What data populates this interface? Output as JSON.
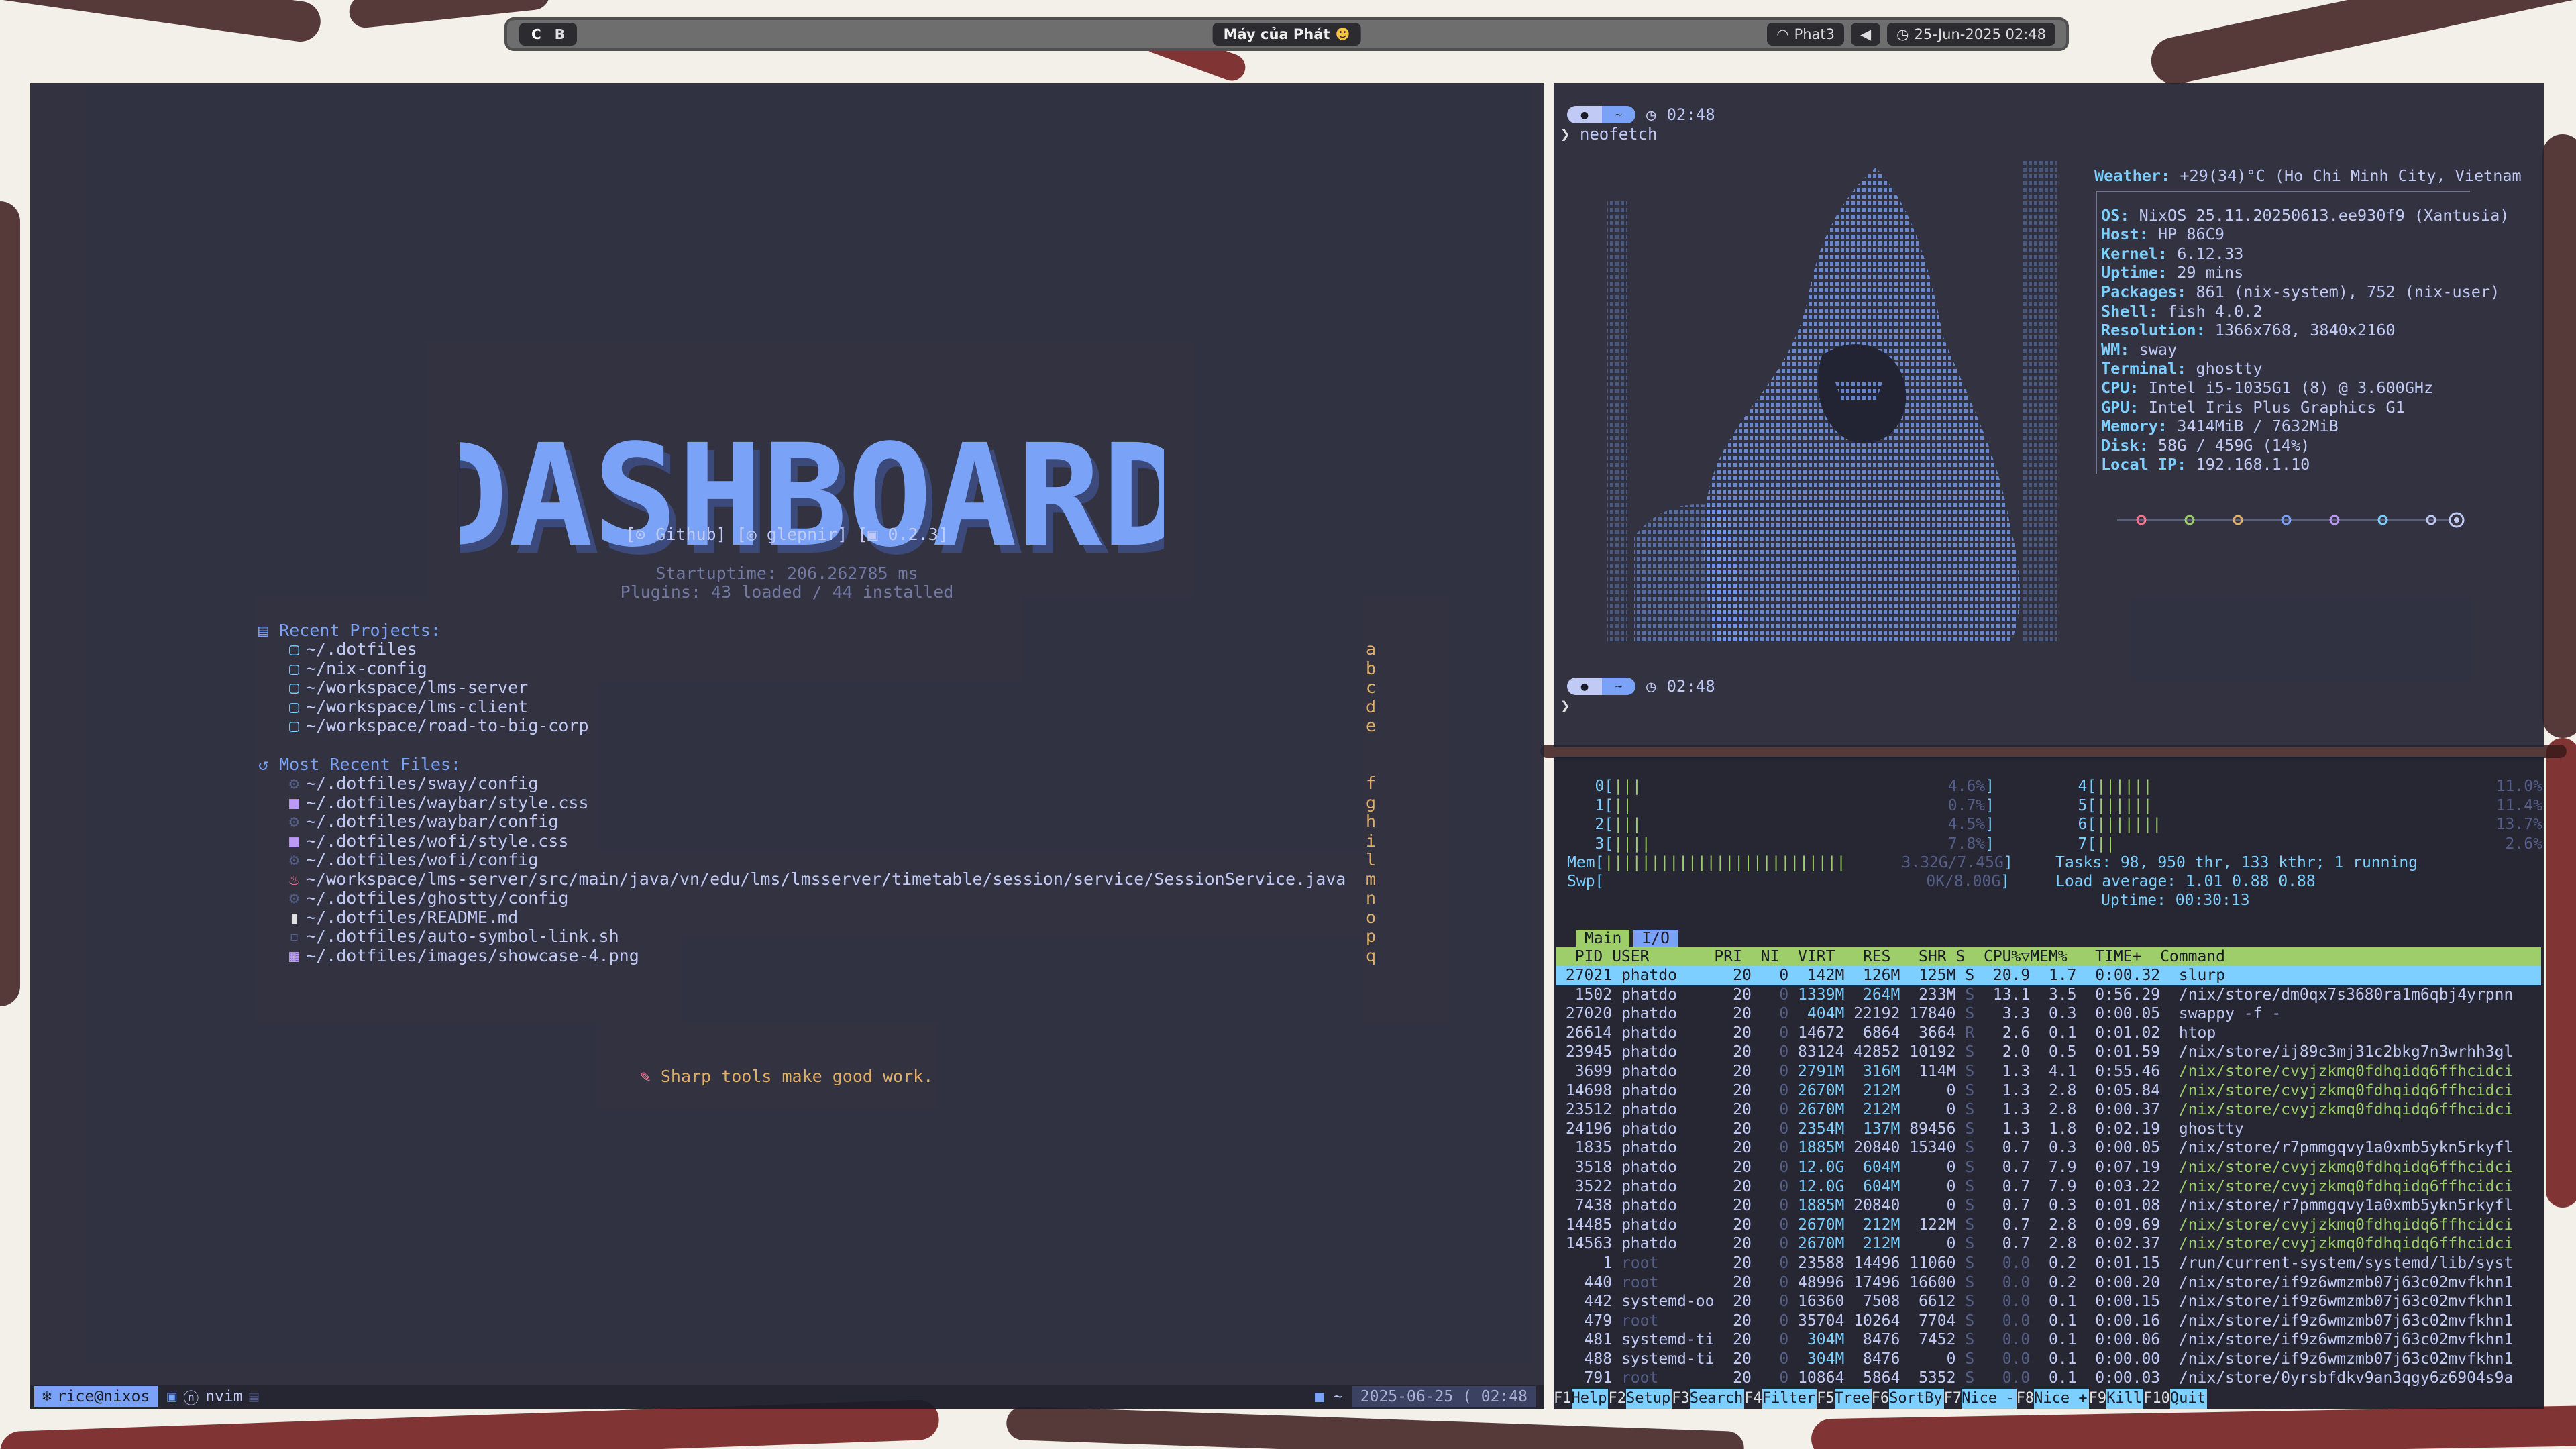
{
  "topbar": {
    "workspaces": [
      "C",
      "B"
    ],
    "title": "Máy của Phát",
    "wifi": "Phat3",
    "datetime": "25-Jun-2025 02:48"
  },
  "nvim": {
    "logo_text": "DASHBOARD",
    "links": {
      "github": "Github",
      "user": "glepnir",
      "version": "0.2.3"
    },
    "startuptime": "Startuptime: 206.262785 ms",
    "plugins": "Plugins: 43 loaded / 44 installed",
    "recent_projects": {
      "title": "Recent Projects:",
      "items": [
        {
          "path": "~/.dotfiles",
          "key": "a"
        },
        {
          "path": "~/nix-config",
          "key": "b"
        },
        {
          "path": "~/workspace/lms-server",
          "key": "c"
        },
        {
          "path": "~/workspace/lms-client",
          "key": "d"
        },
        {
          "path": "~/workspace/road-to-big-corp",
          "key": "e"
        }
      ]
    },
    "recent_files": {
      "title": "Most Recent Files:",
      "items": [
        {
          "path": "~/.dotfiles/sway/config",
          "key": "f",
          "icon": "gear-icon"
        },
        {
          "path": "~/.dotfiles/waybar/style.css",
          "key": "g",
          "icon": "css-icon"
        },
        {
          "path": "~/.dotfiles/waybar/config",
          "key": "h",
          "icon": "gear-icon"
        },
        {
          "path": "~/.dotfiles/wofi/style.css",
          "key": "i",
          "icon": "css-icon"
        },
        {
          "path": "~/.dotfiles/wofi/config",
          "key": "l",
          "icon": "gear-icon"
        },
        {
          "path": "~/workspace/lms-server/src/main/java/vn/edu/lms/lmsserver/timetable/session/service/SessionService.java",
          "key": "m",
          "icon": "java-icon"
        },
        {
          "path": "~/.dotfiles/ghostty/config",
          "key": "n",
          "icon": "gear-icon"
        },
        {
          "path": "~/.dotfiles/README.md",
          "key": "o",
          "icon": "markdown-icon"
        },
        {
          "path": "~/.dotfiles/auto-symbol-link.sh",
          "key": "p",
          "icon": "shell-icon"
        },
        {
          "path": "~/.dotfiles/images/showcase-4.png",
          "key": "q",
          "icon": "image-icon"
        }
      ]
    },
    "quote": "Sharp tools make good work.",
    "statusline": {
      "user": "rice@nixos",
      "mode": "nvim",
      "cwd": "~",
      "datetime": "2025-06-25 ( 02:48"
    }
  },
  "neofetch": {
    "time": "02:48",
    "command": "neofetch",
    "weather_key": "Weather:",
    "weather_val": "+29(34)°C (Ho Chi Minh City, Vietnam",
    "info": [
      {
        "k": "OS:",
        "v": "NixOS 25.11.20250613.ee930f9 (Xantusia)"
      },
      {
        "k": "Host:",
        "v": "HP 86C9"
      },
      {
        "k": "Kernel:",
        "v": "6.12.33"
      },
      {
        "k": "Uptime:",
        "v": "29 mins"
      },
      {
        "k": "Packages:",
        "v": "861 (nix-system), 752 (nix-user)"
      },
      {
        "k": "Shell:",
        "v": "fish 4.0.2"
      },
      {
        "k": "Resolution:",
        "v": "1366x768, 3840x2160"
      },
      {
        "k": "WM:",
        "v": "sway"
      },
      {
        "k": "Terminal:",
        "v": "ghostty"
      },
      {
        "k": "CPU:",
        "v": "Intel i5-1035G1 (8) @ 3.600GHz"
      },
      {
        "k": "GPU:",
        "v": "Intel Iris Plus Graphics G1"
      },
      {
        "k": "Memory:",
        "v": "3414MiB / 7632MiB"
      },
      {
        "k": "Disk:",
        "v": "58G / 459G (14%)"
      },
      {
        "k": "Local IP:",
        "v": "192.168.1.10"
      }
    ],
    "palette": [
      "#f7768e",
      "#9ece6a",
      "#e0af68",
      "#7aa2f7",
      "#bb9af7",
      "#7dcfff",
      "#c0caf5"
    ],
    "time2": "02:48"
  },
  "htop": {
    "cpus_left": [
      {
        "id": "0",
        "bar": "|||",
        "pct": "4.6%"
      },
      {
        "id": "1",
        "bar": "||",
        "pct": "0.7%"
      },
      {
        "id": "2",
        "bar": "|||",
        "pct": "4.5%"
      },
      {
        "id": "3",
        "bar": "||||",
        "pct": "7.8%"
      }
    ],
    "cpus_right": [
      {
        "id": "4",
        "bar": "||||||",
        "pct": "11.0%"
      },
      {
        "id": "5",
        "bar": "||||||",
        "pct": "11.4%"
      },
      {
        "id": "6",
        "bar": "|||||||",
        "pct": "13.7%"
      },
      {
        "id": "7",
        "bar": "||",
        "pct": "2.6%"
      }
    ],
    "mem": "3.32G/7.45G",
    "swp": "0K/8.00G",
    "tasks": "Tasks: 98, 950 thr, 133 kthr; 1 running",
    "load": "Load average: 1.01 0.88 0.88",
    "uptime": "Uptime: 00:30:13",
    "tabs": [
      "Main",
      "I/O"
    ],
    "columns": "  PID USER       PRI  NI  VIRT   RES   SHR S  CPU%▽MEM%   TIME+  Command",
    "rows": [
      [
        "27021",
        "phatdo",
        "20",
        "0",
        "142M",
        "126M",
        "125M",
        "S",
        "20.9",
        "1.7",
        "0:00.32",
        "slurp"
      ],
      [
        "1502",
        "phatdo",
        "20",
        "0",
        "1339M",
        "264M",
        "233M",
        "S",
        "13.1",
        "3.5",
        "0:56.29",
        "/nix/store/dm0qx7s3680ra1m6qbj4yrpnn"
      ],
      [
        "27020",
        "phatdo",
        "20",
        "0",
        "404M",
        "22192",
        "17840",
        "S",
        "3.3",
        "0.3",
        "0:00.05",
        "swappy -f -"
      ],
      [
        "26614",
        "phatdo",
        "20",
        "0",
        "14672",
        "6864",
        "3664",
        "R",
        "2.6",
        "0.1",
        "0:01.02",
        "htop"
      ],
      [
        "23945",
        "phatdo",
        "20",
        "0",
        "83124",
        "42852",
        "10192",
        "S",
        "2.0",
        "0.5",
        "0:01.59",
        "/nix/store/ij89c3mj31c2bkg7n3wrhh3gl"
      ],
      [
        "3699",
        "phatdo",
        "20",
        "0",
        "2791M",
        "316M",
        "114M",
        "S",
        "1.3",
        "4.1",
        "0:55.46",
        "/nix/store/cvyjzkmq0fdhqidq6ffhcidci"
      ],
      [
        "14698",
        "phatdo",
        "20",
        "0",
        "2670M",
        "212M",
        "0",
        "S",
        "1.3",
        "2.8",
        "0:05.84",
        "/nix/store/cvyjzkmq0fdhqidq6ffhcidci"
      ],
      [
        "23512",
        "phatdo",
        "20",
        "0",
        "2670M",
        "212M",
        "0",
        "S",
        "1.3",
        "2.8",
        "0:00.37",
        "/nix/store/cvyjzkmq0fdhqidq6ffhcidci"
      ],
      [
        "24196",
        "phatdo",
        "20",
        "0",
        "2354M",
        "137M",
        "89456",
        "S",
        "1.3",
        "1.8",
        "0:02.19",
        "ghostty"
      ],
      [
        "1835",
        "phatdo",
        "20",
        "0",
        "1885M",
        "20840",
        "15340",
        "S",
        "0.7",
        "0.3",
        "0:00.05",
        "/nix/store/r7pmmgqvy1a0xmb5ykn5rkyfl"
      ],
      [
        "3518",
        "phatdo",
        "20",
        "0",
        "12.0G",
        "604M",
        "0",
        "S",
        "0.7",
        "7.9",
        "0:07.19",
        "/nix/store/cvyjzkmq0fdhqidq6ffhcidci"
      ],
      [
        "3522",
        "phatdo",
        "20",
        "0",
        "12.0G",
        "604M",
        "0",
        "S",
        "0.7",
        "7.9",
        "0:03.22",
        "/nix/store/cvyjzkmq0fdhqidq6ffhcidci"
      ],
      [
        "7438",
        "phatdo",
        "20",
        "0",
        "1885M",
        "20840",
        "0",
        "S",
        "0.7",
        "0.3",
        "0:01.08",
        "/nix/store/r7pmmgqvy1a0xmb5ykn5rkyfl"
      ],
      [
        "14485",
        "phatdo",
        "20",
        "0",
        "2670M",
        "212M",
        "122M",
        "S",
        "0.7",
        "2.8",
        "0:09.69",
        "/nix/store/cvyjzkmq0fdhqidq6ffhcidci"
      ],
      [
        "14563",
        "phatdo",
        "20",
        "0",
        "2670M",
        "212M",
        "0",
        "S",
        "0.7",
        "2.8",
        "0:02.37",
        "/nix/store/cvyjzkmq0fdhqidq6ffhcidci"
      ],
      [
        "1",
        "root",
        "20",
        "0",
        "23588",
        "14496",
        "11060",
        "S",
        "0.0",
        "0.2",
        "0:01.15",
        "/run/current-system/systemd/lib/syst"
      ],
      [
        "440",
        "root",
        "20",
        "0",
        "48996",
        "17496",
        "16600",
        "S",
        "0.0",
        "0.2",
        "0:00.20",
        "/nix/store/if9z6wmzmb07j63c02mvfkhn1"
      ],
      [
        "442",
        "systemd-oo",
        "20",
        "0",
        "16360",
        "7508",
        "6612",
        "S",
        "0.0",
        "0.1",
        "0:00.15",
        "/nix/store/if9z6wmzmb07j63c02mvfkhn1"
      ],
      [
        "479",
        "root",
        "20",
        "0",
        "35704",
        "10264",
        "7704",
        "S",
        "0.0",
        "0.1",
        "0:00.16",
        "/nix/store/if9z6wmzmb07j63c02mvfkhn1"
      ],
      [
        "481",
        "systemd-ti",
        "20",
        "0",
        "304M",
        "8476",
        "7452",
        "S",
        "0.0",
        "0.1",
        "0:00.06",
        "/nix/store/if9z6wmzmb07j63c02mvfkhn1"
      ],
      [
        "488",
        "systemd-ti",
        "20",
        "0",
        "304M",
        "8476",
        "0",
        "S",
        "0.0",
        "0.1",
        "0:00.00",
        "/nix/store/if9z6wmzmb07j63c02mvfkhn1"
      ],
      [
        "791",
        "root",
        "20",
        "0",
        "10864",
        "5864",
        "5352",
        "S",
        "0.0",
        "0.1",
        "0:00.03",
        "/nix/store/0yrsbfdkv9an3qgy6z6904s9a"
      ]
    ],
    "fkeys": [
      {
        "k": "F1",
        "l": "Help  "
      },
      {
        "k": "F2",
        "l": "Setup "
      },
      {
        "k": "F3",
        "l": "Search"
      },
      {
        "k": "F4",
        "l": "Filter"
      },
      {
        "k": "F5",
        "l": "Tree  "
      },
      {
        "k": "F6",
        "l": "SortBy"
      },
      {
        "k": "F7",
        "l": "Nice -"
      },
      {
        "k": "F8",
        "l": "Nice +"
      },
      {
        "k": "F9",
        "l": "Kill  "
      },
      {
        "k": "F10",
        "l": "Quit"
      }
    ]
  }
}
